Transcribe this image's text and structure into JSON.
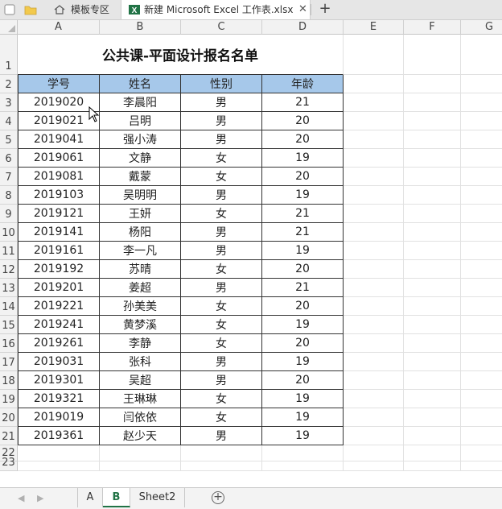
{
  "tabs": [
    {
      "label": "模板专区"
    },
    {
      "label": "新建 Microsoft Excel 工作表.xlsx"
    }
  ],
  "columns": [
    "A",
    "B",
    "C",
    "D",
    "E",
    "F",
    "G"
  ],
  "rows": [
    "1",
    "2",
    "3",
    "4",
    "5",
    "6",
    "7",
    "8",
    "9",
    "10",
    "11",
    "12",
    "13",
    "14",
    "15",
    "16",
    "17",
    "18",
    "19",
    "20",
    "21",
    "22",
    "23"
  ],
  "sheet": {
    "title": "公共课-平面设计报名名单",
    "headers": [
      "学号",
      "姓名",
      "性别",
      "年龄"
    ],
    "records": [
      [
        "2019020",
        "李晨阳",
        "男",
        "21"
      ],
      [
        "2019021",
        "吕明",
        "男",
        "20"
      ],
      [
        "2019041",
        "强小涛",
        "男",
        "20"
      ],
      [
        "2019061",
        "文静",
        "女",
        "19"
      ],
      [
        "2019081",
        "戴蒙",
        "女",
        "20"
      ],
      [
        "2019103",
        "吴明明",
        "男",
        "19"
      ],
      [
        "2019121",
        "王妍",
        "女",
        "21"
      ],
      [
        "2019141",
        "杨阳",
        "男",
        "21"
      ],
      [
        "2019161",
        "李一凡",
        "男",
        "19"
      ],
      [
        "2019192",
        "苏晴",
        "女",
        "20"
      ],
      [
        "2019201",
        "姜超",
        "男",
        "21"
      ],
      [
        "2019221",
        "孙美美",
        "女",
        "20"
      ],
      [
        "2019241",
        "黄梦溪",
        "女",
        "19"
      ],
      [
        "2019261",
        "李静",
        "女",
        "20"
      ],
      [
        "2019031",
        "张科",
        "男",
        "19"
      ],
      [
        "2019301",
        "吴超",
        "男",
        "20"
      ],
      [
        "2019321",
        "王琳琳",
        "女",
        "19"
      ],
      [
        "2019019",
        "闫依依",
        "女",
        "19"
      ],
      [
        "2019361",
        "赵少天",
        "男",
        "19"
      ]
    ]
  },
  "sheet_tabs": [
    {
      "label": "A"
    },
    {
      "label": "B"
    },
    {
      "label": "Sheet2"
    }
  ],
  "active_sheet": "B",
  "colors": {
    "header_fill": "#a6c8ea",
    "excel_green": "#217346",
    "folder_yellow": "#f2c94c"
  },
  "icons": {
    "app": "app-square-icon",
    "folder": "folder-icon",
    "home": "home-icon",
    "excel": "excel-file-icon",
    "close": "close-icon",
    "add": "plus-icon"
  }
}
